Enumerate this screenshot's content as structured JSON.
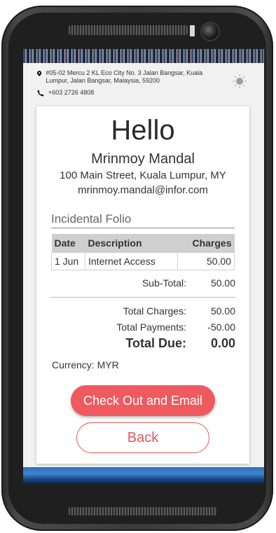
{
  "hotel": {
    "address": "#05-02 Mercu 2 KL Eco City No. 3 Jalan Bangsar, Kuala Lumpur, Jalan Bangsar, Malaysia, 59200",
    "phone": "+603 2726 4808"
  },
  "guest": {
    "greeting": "Hello",
    "name": "Mrinmoy Mandal",
    "address": "100 Main Street, Kuala Lumpur, MY",
    "email": "mrinmoy.mandal@infor.com"
  },
  "folio": {
    "title": "Incidental Folio",
    "columns": [
      "Date",
      "Description",
      "Charges"
    ],
    "rows": [
      {
        "date": "1 Jun",
        "description": "Internet Access",
        "charges": "50.00"
      }
    ]
  },
  "summary": {
    "subtotal_label": "Sub-Total:",
    "subtotal_value": "50.00",
    "total_charges_label": "Total Charges:",
    "total_charges_value": "50.00",
    "total_payments_label": "Total Payments:",
    "total_payments_value": "-50.00",
    "total_due_label": "Total Due:",
    "total_due_value": "0.00"
  },
  "currency": "Currency: MYR",
  "buttons": {
    "checkout": "Check Out and Email",
    "back": "Back"
  },
  "icons": {
    "location": "map-pin-icon",
    "phone": "phone-icon",
    "weather": "sun-cloud-icon"
  },
  "colors": {
    "accent": "#ef5a5f"
  }
}
